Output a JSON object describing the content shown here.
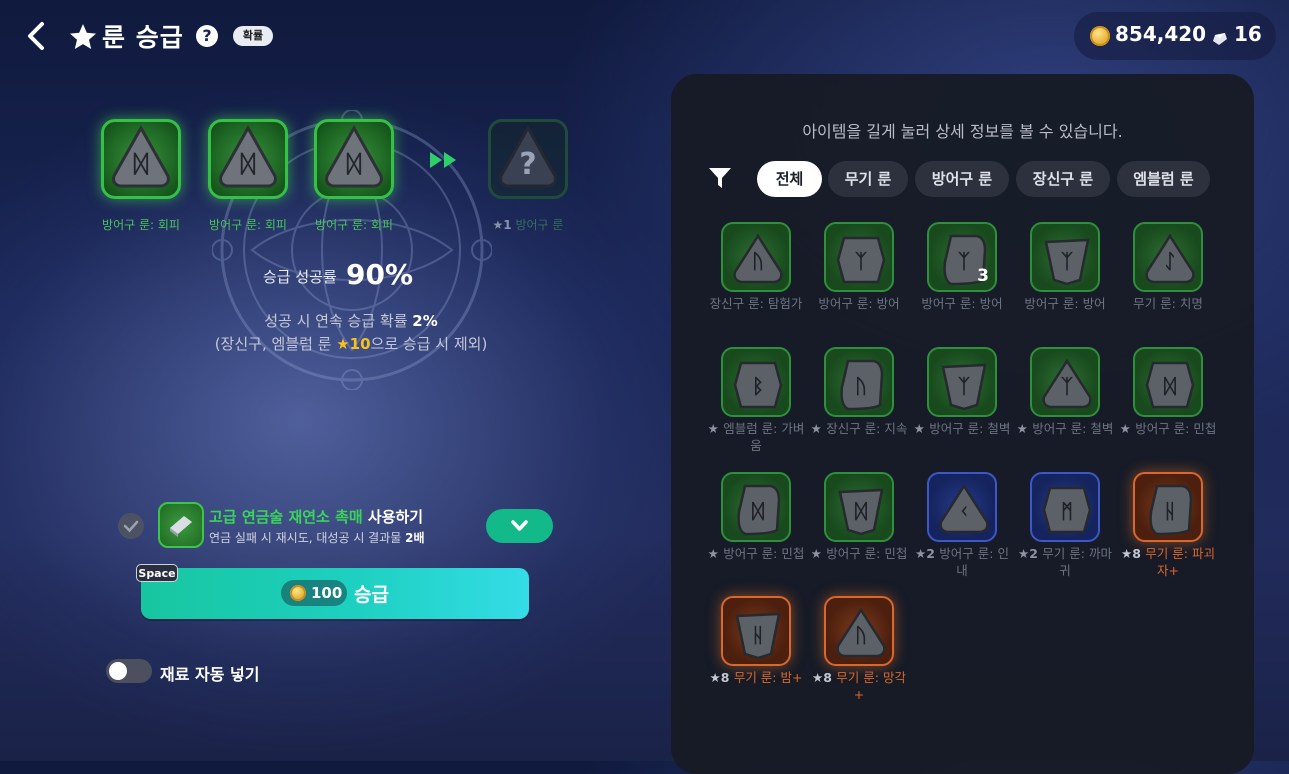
{
  "header": {
    "title": "룬 승급",
    "help": "?",
    "probability_badge": "확률",
    "gold": "854,420",
    "gems": "16"
  },
  "slots": [
    {
      "label": "방어구 룬: 회피",
      "filled": true
    },
    {
      "label": "방어구 룬: 회피",
      "filled": true
    },
    {
      "label": "방어구 룬: 회피",
      "filled": true
    },
    {
      "label": "방어구 룬",
      "star": "★1",
      "filled": false
    }
  ],
  "rate": {
    "label": "승급 성공률",
    "value": "90%"
  },
  "continuous": {
    "line1_pre": "성공 시 연속 승급 확률 ",
    "line1_value": "2%",
    "line2_pre": "(장신구, 엠블럼 룬 ",
    "line2_star": "★10",
    "line2_post": "으로 승급 시 제외)"
  },
  "catalyst": {
    "name": "고급 연금술 재연소 촉매",
    "action": " 사용하기",
    "desc_pre": "연금 실패 시 재시도, 대성공 시 결과물 ",
    "desc_value": "2배"
  },
  "upgrade_button": {
    "cost": "100",
    "label": "승급",
    "hotkey": "Space"
  },
  "auto_fill": {
    "label": "재료 자동 넣기",
    "enabled": false
  },
  "inventory": {
    "hint": "아이템을 길게 눌러 상세 정보를 볼 수 있습니다.",
    "filters": [
      "전체",
      "무기 룬",
      "방어구 룬",
      "장신구 룬",
      "엠블럼 룬"
    ],
    "active_filter": 0,
    "items": [
      {
        "star": "",
        "name": "장신구 룬: 탐험가",
        "tier": "green",
        "glyph": "ᚢ",
        "count": ""
      },
      {
        "star": "",
        "name": "방어구 룬: 방어",
        "tier": "green",
        "glyph": "ᛉ",
        "count": ""
      },
      {
        "star": "",
        "name": "방어구 룬: 방어",
        "tier": "green",
        "glyph": "ᛉ",
        "count": "3"
      },
      {
        "star": "",
        "name": "방어구 룬: 방어",
        "tier": "green",
        "glyph": "ᛉ",
        "count": ""
      },
      {
        "star": "",
        "name": "무기 룬: 치명",
        "tier": "green",
        "glyph": "ᛇ",
        "count": ""
      },
      {
        "star": "★",
        "name": "엠블럼 룬: 가벼움",
        "tier": "green",
        "glyph": "ᛒ",
        "count": ""
      },
      {
        "star": "★",
        "name": "장신구 룬: 지속",
        "tier": "green",
        "glyph": "ᚢ",
        "count": ""
      },
      {
        "star": "★",
        "name": "방어구 룬: 철벽",
        "tier": "green",
        "glyph": "ᛉ",
        "count": ""
      },
      {
        "star": "★",
        "name": "방어구 룬: 철벽",
        "tier": "green",
        "glyph": "ᛉ",
        "count": ""
      },
      {
        "star": "★",
        "name": "방어구 룬: 민첩",
        "tier": "green",
        "glyph": "ᛞ",
        "count": ""
      },
      {
        "star": "★",
        "name": "방어구 룬: 민첩",
        "tier": "green",
        "glyph": "ᛞ",
        "count": ""
      },
      {
        "star": "★",
        "name": "방어구 룬: 민첩",
        "tier": "green",
        "glyph": "ᛞ",
        "count": ""
      },
      {
        "star": "★2",
        "name": "방어구 룬: 인내",
        "tier": "blue",
        "glyph": "ᚲ",
        "count": ""
      },
      {
        "star": "★2",
        "name": "무기 룬: 까마귀",
        "tier": "blue",
        "glyph": "ᛗ",
        "count": ""
      },
      {
        "star": "★8",
        "name": "무기 룬: 파괴자+",
        "tier": "orange",
        "glyph": "ᚺ",
        "count": ""
      },
      {
        "star": "★8",
        "name": "무기 룬: 밤+",
        "tier": "orange",
        "glyph": "ᚺ",
        "count": ""
      },
      {
        "star": "★8",
        "name": "무기 룬: 망각+",
        "tier": "orange",
        "glyph": "ᚢ",
        "count": ""
      }
    ]
  },
  "colors": {
    "accent_green": "#39d45a",
    "button_teal": "#1ed0c0",
    "star_gold": "#f4c21a",
    "tier_orange": "#d9682c",
    "tier_blue": "#3d57c6"
  }
}
